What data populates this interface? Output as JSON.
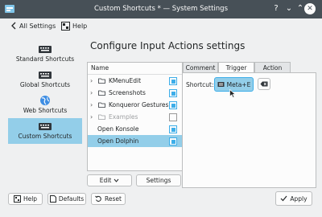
{
  "window": {
    "title": "Custom Shortcuts * — System Settings",
    "help_glyph": "?",
    "minimize_glyph": "⌄",
    "maximize_glyph": "⌃",
    "close_glyph": "✕"
  },
  "toolbar": {
    "back_label": "All Settings",
    "help_label": "Help"
  },
  "sidebar": {
    "items": [
      {
        "label": "Standard Shortcuts",
        "icon": "keyboard-icon"
      },
      {
        "label": "Global Shortcuts",
        "icon": "keyboard-icon"
      },
      {
        "label": "Web Shortcuts",
        "icon": "globe-icon"
      },
      {
        "label": "Custom Shortcuts",
        "icon": "keyboard-icon",
        "active": true
      }
    ]
  },
  "main": {
    "title": "Configure Input Actions settings"
  },
  "tree": {
    "header": "Name",
    "rows": [
      {
        "label": "KMenuEdit",
        "checked": true,
        "folder": true
      },
      {
        "label": "Screenshots",
        "checked": true,
        "folder": true
      },
      {
        "label": "Konqueror Gestures",
        "checked": true,
        "folder": true
      },
      {
        "label": "Examples",
        "checked": false,
        "folder": true,
        "disabled": true
      },
      {
        "label": "Open Konsole",
        "checked": true,
        "folder": false
      },
      {
        "label": "Open Dolphin",
        "checked": true,
        "folder": false,
        "selected": true
      }
    ]
  },
  "tree_buttons": {
    "edit_label": "Edit",
    "settings_label": "Settings"
  },
  "tabs": [
    {
      "label": "Comment"
    },
    {
      "label": "Trigger",
      "active": true
    },
    {
      "label": "Action"
    }
  ],
  "trigger": {
    "shortcut_label": "Shortcut:",
    "shortcut_value": "Meta+E"
  },
  "footer": {
    "help_label": "Help",
    "defaults_label": "Defaults",
    "reset_label": "Reset",
    "apply_label": "Apply"
  },
  "colors": {
    "titlebar": "#475057",
    "accent": "#3daee9",
    "selection": "#93cee9",
    "window": "#eff0f1"
  }
}
